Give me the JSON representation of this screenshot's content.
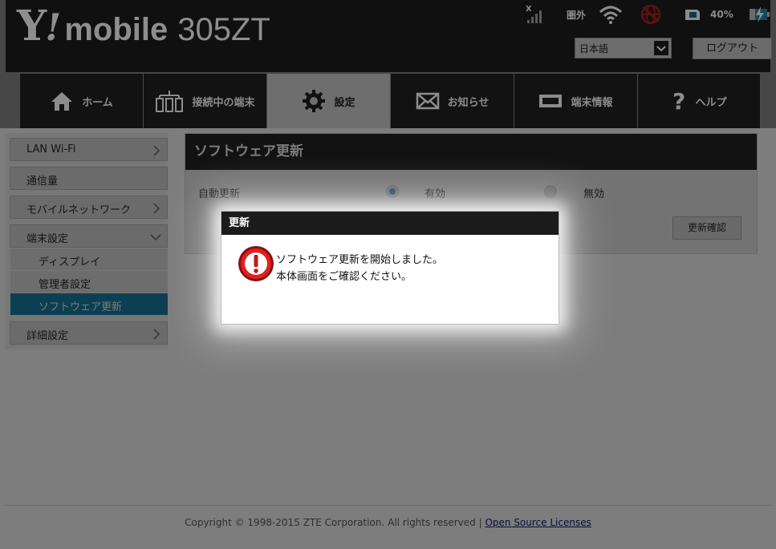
{
  "header": {
    "logo": {
      "y": "Y",
      "excl": "!",
      "mobile": "mobile",
      "model": "305ZT"
    },
    "status": {
      "roaming_text": "圏外",
      "battery_percent": "40%",
      "icons": [
        "signal-no-service-icon",
        "wifi-icon",
        "network-disconnected-icon",
        "sim-icon",
        "battery-charging-icon"
      ]
    },
    "language": {
      "selected": "日本語"
    },
    "logout_label": "ログアウト"
  },
  "nav": {
    "items": [
      {
        "label": "ホーム",
        "icon": "home-icon"
      },
      {
        "label": "接続中の端末",
        "icon": "connected-devices-icon"
      },
      {
        "label": "設定",
        "icon": "gear-icon",
        "active": true
      },
      {
        "label": "お知らせ",
        "icon": "envelope-icon"
      },
      {
        "label": "端末情報",
        "icon": "device-info-icon"
      },
      {
        "label": "ヘルプ",
        "icon": "help-icon"
      }
    ]
  },
  "sidebar": {
    "items": [
      {
        "label": "LAN Wi-Fi"
      },
      {
        "label": "通信量"
      },
      {
        "label": "モバイルネットワーク"
      },
      {
        "label": "端末設定",
        "expanded": true,
        "children": [
          {
            "label": "ディスプレイ"
          },
          {
            "label": "管理者設定"
          },
          {
            "label": "ソフトウェア更新",
            "active": true
          }
        ]
      },
      {
        "label": "詳細設定"
      }
    ]
  },
  "main": {
    "title": "ソフトウェア更新",
    "auto_update": {
      "label": "自動更新",
      "options": [
        {
          "label": "有効",
          "selected": true
        },
        {
          "label": "無効",
          "selected": false
        }
      ]
    },
    "check_button": "更新確認"
  },
  "dialog": {
    "title": "更新",
    "icon": "error-icon",
    "message_line1": "ソフトウェア更新を開始しました。",
    "message_line2": "本体画面をご確認ください。"
  },
  "footer": {
    "copyright": "Copyright © 1998-2015 ZTE Corporation. All rights reserved | ",
    "link": "Open Source Licenses"
  },
  "colors": {
    "header_bg": "#101010",
    "accent_active": "#0c3f52",
    "dialog_title_bg": "#1b1b1b",
    "error_red": "#d42020"
  }
}
